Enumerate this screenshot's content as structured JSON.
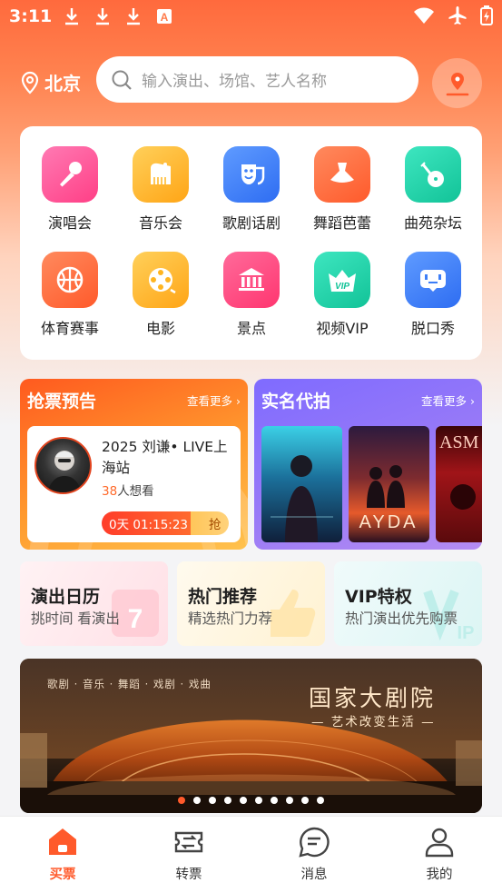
{
  "status_bar": {
    "time": "3:11"
  },
  "header": {
    "city": "北京",
    "search_placeholder": "输入演出、场馆、艺人名称"
  },
  "categories": [
    {
      "label": "演唱会",
      "icon": "microphone-icon",
      "color": "#ff4d95"
    },
    {
      "label": "音乐会",
      "icon": "piano-icon",
      "color": "#ffb020"
    },
    {
      "label": "歌剧话剧",
      "icon": "theater-masks-icon",
      "color": "#3d7ef7"
    },
    {
      "label": "舞蹈芭蕾",
      "icon": "ballet-dress-icon",
      "color": "#ff6f3c"
    },
    {
      "label": "曲苑杂坛",
      "icon": "pipa-instrument-icon",
      "color": "#1fcfa6"
    },
    {
      "label": "体育赛事",
      "icon": "basketball-icon",
      "color": "#ff6f3c"
    },
    {
      "label": "电影",
      "icon": "film-reel-icon",
      "color": "#ffb020"
    },
    {
      "label": "景点",
      "icon": "museum-icon",
      "color": "#ff4d7f"
    },
    {
      "label": "视频VIP",
      "icon": "vip-crown-icon",
      "color": "#1fcfa6"
    },
    {
      "label": "脱口秀",
      "icon": "talkshow-icon",
      "color": "#3d7ef7"
    }
  ],
  "ticket_preview": {
    "title": "抢票预告",
    "more": "查看更多",
    "show_name": "2025 刘谦• LIVE上海站",
    "want_count": "38",
    "want_suffix": "人想看",
    "countdown": "0天 01:15:23",
    "grab": "抢"
  },
  "realname": {
    "title": "实名代拍",
    "more": "查看更多",
    "poster_texts": [
      "AYDA",
      "ASM"
    ]
  },
  "promos": [
    {
      "title": "演出日历",
      "subtitle": "挑时间 看演出"
    },
    {
      "title": "热门推荐",
      "subtitle": "精选热门力荐"
    },
    {
      "title": "VIP特权",
      "subtitle": "热门演出优先购票"
    }
  ],
  "banner": {
    "tags": "歌剧 · 音乐 · 舞蹈 · 戏剧 · 戏曲",
    "title": "国家大剧院",
    "subtitle": "— 艺术改变生活 —",
    "dot_count": 10,
    "active_dot": 0
  },
  "tabbar": [
    {
      "label": "买票",
      "icon": "house-ticket-icon",
      "active": true
    },
    {
      "label": "转票",
      "icon": "ticket-transfer-icon",
      "active": false
    },
    {
      "label": "消息",
      "icon": "chat-bubble-icon",
      "active": false
    },
    {
      "label": "我的",
      "icon": "user-profile-icon",
      "active": false
    }
  ],
  "colors": {
    "accent": "#ff5a2b",
    "brand_orange": "#ff6a3d",
    "purple": "#8b72ff"
  }
}
